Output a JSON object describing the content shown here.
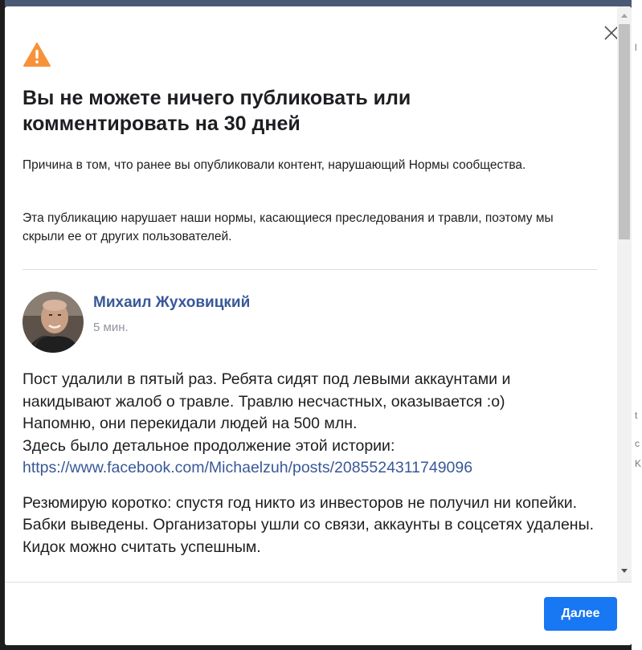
{
  "dialog": {
    "title": "Вы не можете ничего публиковать или комментировать на 30 дней",
    "reason_1": "Причина в том, что ранее вы опубликовали контент, нарушающий Нормы сообщества.",
    "reason_2": "Эта публикацию нарушает наши нормы, касающиеся преследования и травли, поэтому мы скрыли ее от других пользователей."
  },
  "post": {
    "author": "Михаил Жуховицкий",
    "time": "5 мин.",
    "paragraph_1_lines": [
      "Пост удалили в пятый раз. Ребята сидят под левыми аккаунтами и",
      "накидывают жалоб о травле. Травлю несчастных, оказывается :о)",
      "Напомню, они перекидали людей на 500 млн.",
      "Здесь было детальное продолжение этой истории:"
    ],
    "link": "https://www.facebook.com/Michaelzuh/posts/2085524311749096",
    "paragraph_2": "Резюмирую коротко: спустя год никто из инвесторов не получил ни копейки. Бабки выведены. Организаторы ушли со связи, аккаунты в соцсетях удалены. Кидок можно считать успешным."
  },
  "footer": {
    "next_label": "Далее"
  },
  "background_peek": [
    "l",
    "t",
    "c",
    "K"
  ],
  "icons": {
    "warning": "warning-triangle-icon",
    "close": "close-icon",
    "scroll_up": "scroll-up-arrow-icon",
    "scroll_down": "scroll-down-arrow-icon"
  },
  "colors": {
    "link": "#385898",
    "primary_button": "#1877f2",
    "warning": "#f7923b"
  }
}
